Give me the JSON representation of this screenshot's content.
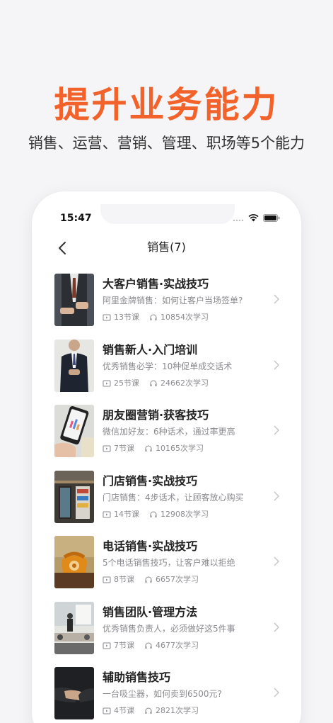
{
  "hero": {
    "title": "提升业务能力",
    "subtitle": "销售、运营、营销、管理、职场等5个能力"
  },
  "status_bar": {
    "time": "15:47"
  },
  "nav": {
    "title": "销售(7)"
  },
  "courses": [
    {
      "title": "大客户销售·实战技巧",
      "desc": "阿里金牌销售：如何让客户当场签单?",
      "lessons": "13节课",
      "listens": "10854次学习"
    },
    {
      "title": "销售新人·入门培训",
      "desc": "优秀销售必学：10种促单成交话术",
      "lessons": "25节课",
      "listens": "24662次学习"
    },
    {
      "title": "朋友圈营销·获客技巧",
      "desc": "微信加好友：6种话术，通过率更高",
      "lessons": "7节课",
      "listens": "10165次学习"
    },
    {
      "title": "门店销售·实战技巧",
      "desc": "门店销售：4步话术，让顾客放心购买",
      "lessons": "14节课",
      "listens": "12908次学习"
    },
    {
      "title": "电话销售·实战技巧",
      "desc": "5个电话销售技巧，让客户难以拒绝",
      "lessons": "8节课",
      "listens": "6657次学习"
    },
    {
      "title": "销售团队·管理方法",
      "desc": "优秀销售负责人，必须做好这5件事",
      "lessons": "7节课",
      "listens": "4677次学习"
    },
    {
      "title": "辅助销售技巧",
      "desc": "一台吸尘器，如何卖到6500元?",
      "lessons": "4节课",
      "listens": "2821次学习"
    }
  ],
  "colors": {
    "accent": "#f2622a",
    "text": "#222222",
    "muted": "#8a8a8f"
  }
}
